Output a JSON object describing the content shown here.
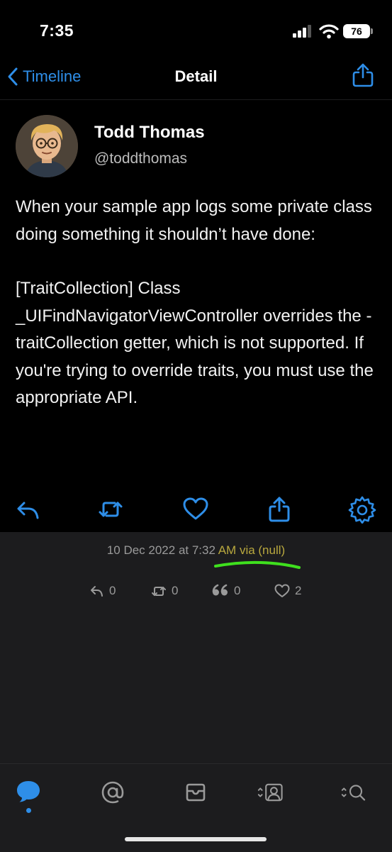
{
  "status_bar": {
    "time": "7:35",
    "battery": "76"
  },
  "nav": {
    "back_label": "Timeline",
    "title": "Detail"
  },
  "tweet": {
    "author_name": "Todd Thomas",
    "author_handle": "@toddthomas",
    "paragraphs": [
      "When your sample app logs some private class doing something it shouldn’t have done:",
      "[TraitCollection] Class _UIFindNavigatorViewController overrides the -traitCollection getter, which is not supported. If you're trying to override traits, you must use the appropriate API."
    ]
  },
  "meta": {
    "timestamp": "10 Dec 2022 at 7:32",
    "highlighted": " AM via (null)"
  },
  "counts": {
    "replies": "0",
    "retweets": "0",
    "quotes": "0",
    "likes": "2"
  },
  "icons": {
    "actions": [
      "reply-icon",
      "retweet-icon",
      "like-icon",
      "share-icon",
      "settings-icon"
    ],
    "tabs": [
      "timeline-tab-icon",
      "mentions-tab-icon",
      "messages-tab-icon",
      "profile-tab-icon",
      "search-tab-icon"
    ]
  },
  "colors": {
    "accent": "#2e8ee8",
    "highlight_text": "#b9a83e",
    "marker_underline": "#3fe01e",
    "panel_bg": "#1c1c1e"
  }
}
